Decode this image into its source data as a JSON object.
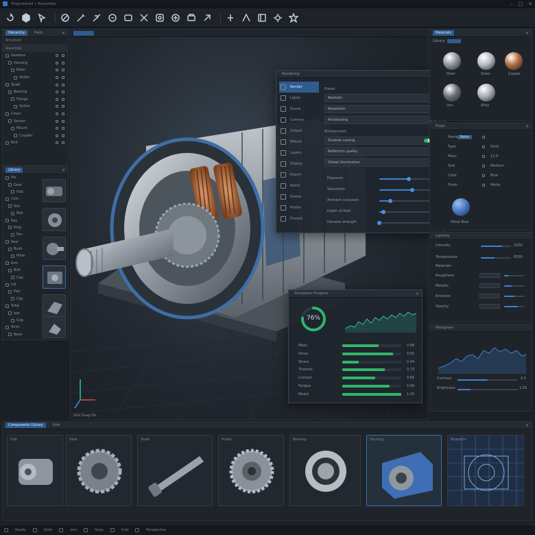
{
  "window": {
    "title": "Engineered • Assembly",
    "controls": [
      "–",
      "□",
      "✕"
    ]
  },
  "toolbar": {
    "tools": [
      {
        "name": "rotate-tool-icon"
      },
      {
        "name": "cube-tool-icon"
      },
      {
        "name": "select-tool-icon"
      },
      {
        "name": "measure-tool-icon"
      },
      {
        "name": "snap-tool-icon"
      },
      {
        "name": "cut-tool-icon"
      },
      {
        "name": "scale-tool-icon"
      },
      {
        "name": "pan-tool-icon"
      },
      {
        "name": "view-tool-icon"
      },
      {
        "name": "camera-tool-icon"
      },
      {
        "name": "copy-tool-icon"
      },
      {
        "name": "sketch-tool-icon"
      },
      {
        "name": "extrude-tool-icon"
      },
      {
        "name": "section-tool-icon"
      },
      {
        "name": "frame-tool-icon"
      },
      {
        "name": "assembly-tool-icon"
      },
      {
        "name": "settings-tool-icon"
      },
      {
        "name": "render-tool-icon"
      }
    ]
  },
  "left_panel": {
    "tabs": [
      "Hierarchy",
      "Parts"
    ],
    "header": "Structure",
    "tree_header": "Assembly",
    "tree_items": [
      "Gearbox",
      "Housing",
      "Rotor",
      "Stator",
      "Shaft",
      "Bearing",
      "Flange",
      "Spline",
      "Cover",
      "Sensor",
      "Mount",
      "Coupler",
      "Bolt"
    ],
    "parts_header": "Library",
    "parts_items": [
      "Pin",
      "Gear",
      "Hub",
      "Cam",
      "Nut",
      "Rod",
      "Key",
      "Ring",
      "Fan",
      "Seal",
      "Bush",
      "Plate",
      "Arm",
      "Bolt",
      "Cap",
      "Lid",
      "Pad",
      "Clip",
      "Tube",
      "Jaw",
      "Cog",
      "Shim",
      "Base"
    ]
  },
  "viewport": {
    "axis_labels": [
      "X",
      "Y",
      "Z"
    ],
    "footer": "Grid  Snap  On"
  },
  "render_panel": {
    "title": "Rendering",
    "side_items": [
      "Render",
      "Lights",
      "Scene",
      "Camera",
      "Output",
      "Effects",
      "Layers",
      "Display",
      "Export",
      "Batch",
      "Queue",
      "Profile",
      "Presets"
    ],
    "section": "Preset",
    "dropdowns": [
      "Realistic",
      "Resolution",
      "Antialiasing"
    ],
    "section2": "Environment",
    "toggle_label": "Shadow casting",
    "dropdown2": [
      "Reflection quality",
      "Global illumination"
    ],
    "sliders": [
      {
        "label": "Exposure",
        "value": 0.55
      },
      {
        "label": "Saturation",
        "value": 0.62
      },
      {
        "label": "Ambient occlusion",
        "value": 0.2
      },
      {
        "label": "Depth of field",
        "value": 0.08
      },
      {
        "label": "Denoise strength",
        "value": 0.0
      }
    ]
  },
  "analysis_panel": {
    "title": "Simulation Progress",
    "progress_label": "76%",
    "progress": 0.76,
    "bars": [
      {
        "label": "Mesh",
        "value": 0.62,
        "num": "0.88"
      },
      {
        "label": "Solve",
        "value": 0.86,
        "num": "0.95"
      },
      {
        "label": "Stress",
        "value": 0.28,
        "num": "0.44"
      },
      {
        "label": "Thermal",
        "value": 0.72,
        "num": "0.73"
      },
      {
        "label": "Contact",
        "value": 0.56,
        "num": "0.66"
      },
      {
        "label": "Fatigue",
        "value": 0.8,
        "num": "0.90"
      },
      {
        "label": "Modal",
        "value": 1.0,
        "num": "1.00"
      }
    ]
  },
  "materials_panel": {
    "tabs": [
      "Materials"
    ],
    "header": "Library",
    "swatches": [
      {
        "label": "Steel",
        "color": "#8e959c"
      },
      {
        "label": "Silver",
        "color": "#b5bcc2"
      },
      {
        "label": "Copper",
        "color": "#b56a3c"
      },
      {
        "label": "Iron",
        "color": "#6c7278"
      },
      {
        "label": "Alloy",
        "color": "#a8aeb4"
      }
    ]
  },
  "properties_panel": {
    "header": "Props",
    "rows": [
      "Name",
      "Type",
      "Mass",
      "Size",
      "Color",
      "Finish"
    ],
    "values": [
      "Rotor",
      "Solid",
      "12.4",
      "Medium",
      "Blue",
      "Matte"
    ],
    "preview_label": "Metal Blue",
    "preview_color": "#3f6eb5"
  },
  "lighting_panel": {
    "header": "Lighting",
    "rows": [
      "Intensity",
      "Temperature"
    ],
    "values": [
      "1000",
      "6500"
    ],
    "extra_header": "Materials",
    "extra_rows": [
      "Roughness",
      "Metallic",
      "Emission",
      "Opacity"
    ]
  },
  "graph_panel": {
    "header": "Histogram",
    "footer_labels": [
      "Contrast",
      "Brightness"
    ],
    "footer_values": [
      "0.5",
      "1.00"
    ]
  },
  "bottom_panel": {
    "tabs": [
      "Components Library",
      "Grid"
    ],
    "cards": [
      "Hub",
      "Gear",
      "Shaft",
      "Pulley",
      "Bearing",
      "Housing",
      "Blueprint"
    ]
  },
  "statusbar": {
    "items": [
      "Ready",
      "Units",
      "mm",
      "Snap",
      "Grid",
      "Perspective"
    ]
  },
  "colors": {
    "accent": "#3a78c8",
    "progress": "#2fb56a",
    "teal": "#2fc4a0"
  }
}
